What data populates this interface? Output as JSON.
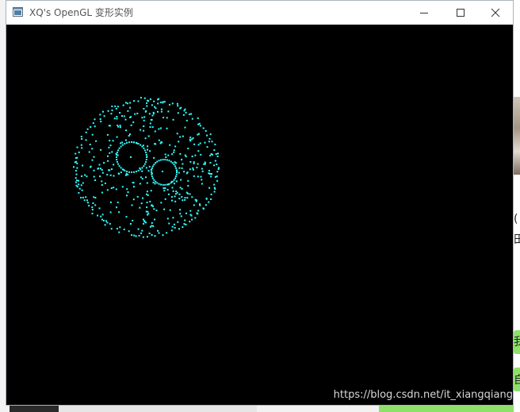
{
  "window": {
    "title": "XQ's OpenGL 变形实例",
    "app_icon": "opengl-window-icon",
    "controls": {
      "minimize": "minimize-icon",
      "maximize": "maximize-icon",
      "close": "close-icon"
    }
  },
  "scene": {
    "background_color": "#000000",
    "point_color": "#33ffff",
    "description_icon": "point-cloud"
  },
  "watermark": "https://blog.csdn.net/it_xiangqiang",
  "background_app": {
    "glyph_paren": "(",
    "glyph_1": "田",
    "glyph_2": "我",
    "glyph_3": "自"
  }
}
